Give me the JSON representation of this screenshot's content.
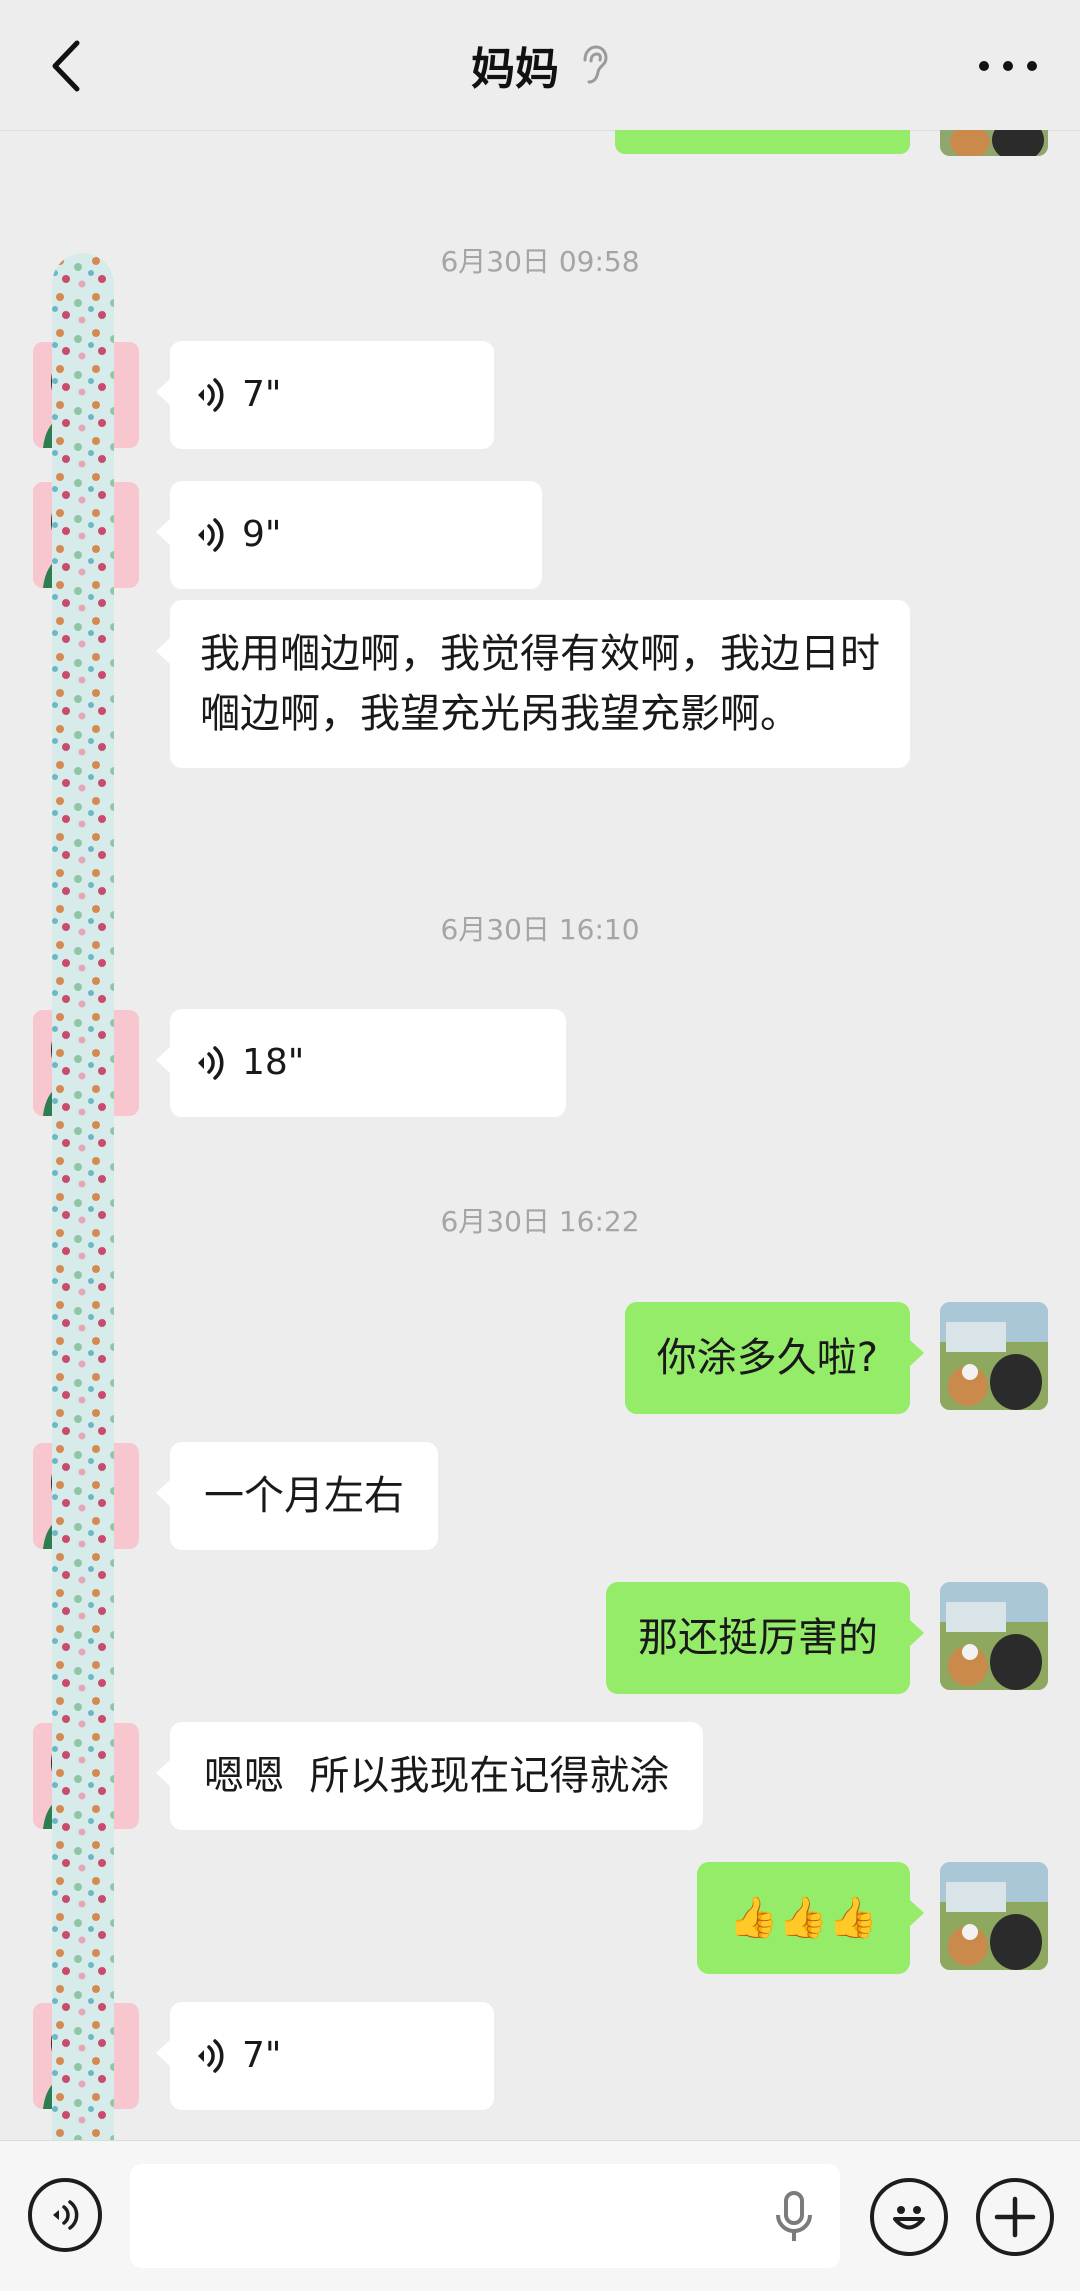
{
  "header": {
    "title": "妈妈",
    "back_icon": "chevron-left-icon",
    "status_icon": "ear-icon",
    "more_icon": "more-dots-icon"
  },
  "chat": {
    "timestamps": [
      "6月30日 09:58",
      "6月30日 16:10",
      "6月30日 16:22"
    ],
    "messages": [
      {
        "side": "left",
        "type": "voice",
        "duration": "7\""
      },
      {
        "side": "left",
        "type": "voice",
        "duration": "9\""
      },
      {
        "side": "left",
        "type": "text",
        "text": "我用嗰边啊，我觉得有效啊，我边日时嗰边啊，我望充光呙我望充影啊。"
      },
      {
        "side": "left",
        "type": "voice",
        "duration": "18\""
      },
      {
        "side": "right",
        "type": "text",
        "text": "你涂多久啦?"
      },
      {
        "side": "left",
        "type": "text",
        "text": "一个月左右"
      },
      {
        "side": "right",
        "type": "text",
        "text": "那还挺厉害的"
      },
      {
        "side": "left",
        "type": "text",
        "text": "嗯嗯  所以我现在记得就涂"
      },
      {
        "side": "right",
        "type": "text",
        "text": "👍👍👍"
      },
      {
        "side": "left",
        "type": "voice",
        "duration": "7\""
      }
    ]
  },
  "input_bar": {
    "voice_toggle_icon": "voice-mode-icon",
    "message_value": "",
    "mic_icon": "mic-icon",
    "emoji_icon": "emoji-icon",
    "plus_icon": "plus-icon"
  },
  "colors": {
    "background": "#ededed",
    "bubble_self": "#95ec69",
    "bubble_other": "#ffffff",
    "timestamp": "#a5a5a5"
  }
}
